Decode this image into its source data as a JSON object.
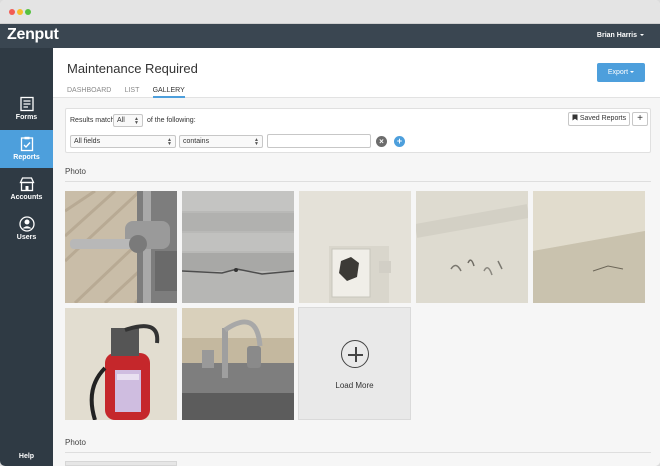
{
  "app": {
    "logo": "Zenput"
  },
  "topbar": {
    "user_name": "Brian Harris"
  },
  "sidebar": {
    "items": [
      {
        "label": "Forms",
        "icon": "forms-icon"
      },
      {
        "label": "Reports",
        "icon": "reports-icon"
      },
      {
        "label": "Accounts",
        "icon": "accounts-icon"
      },
      {
        "label": "Users",
        "icon": "users-icon"
      }
    ],
    "help_label": "Help"
  },
  "header": {
    "title": "Maintenance Required",
    "tabs": [
      {
        "label": "DASHBOARD"
      },
      {
        "label": "LIST"
      },
      {
        "label": "GALLERY"
      }
    ],
    "active_tab": "GALLERY",
    "export_label": "Export"
  },
  "filter": {
    "results_match_label": "Results match",
    "match_value": "All",
    "of_following_label": "of the following:",
    "field_value": "All fields",
    "operator_value": "contains",
    "text_value": "",
    "saved_reports_label": "Saved Reports",
    "add_label": "+"
  },
  "gallery": {
    "section_label": "Photo",
    "load_more_label": "Load More",
    "photos": [
      {
        "subject": "water-valve-photo"
      },
      {
        "subject": "floor-tile-crack-photo"
      },
      {
        "subject": "wall-hole-outlet-photo"
      },
      {
        "subject": "scuffed-wall-photo"
      },
      {
        "subject": "ceiling-crack-photo"
      },
      {
        "subject": "fire-extinguisher-photo"
      },
      {
        "subject": "sink-faucet-photo"
      }
    ]
  },
  "gallery2": {
    "section_label": "Photo"
  },
  "colors": {
    "accent": "#4d9fdc",
    "topbar": "#3a4651",
    "sidebar": "#2f3a44"
  }
}
